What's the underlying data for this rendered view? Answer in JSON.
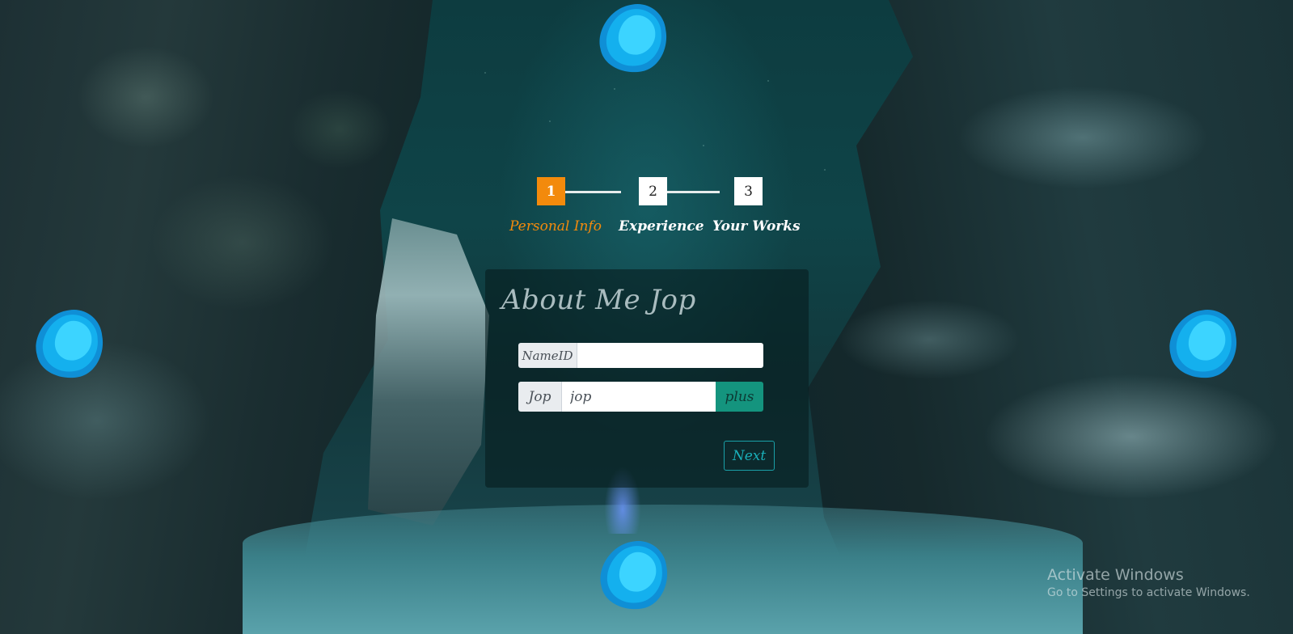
{
  "stepper": {
    "steps": [
      {
        "number": "1",
        "label": "Personal Info",
        "active": true
      },
      {
        "number": "2",
        "label": "Experience",
        "active": false
      },
      {
        "number": "3",
        "label": "Your Works",
        "active": false
      }
    ]
  },
  "form": {
    "title": "About Me Jop",
    "name_field": {
      "prefix": "NameID",
      "value": "",
      "placeholder": ""
    },
    "job_field": {
      "prefix": "Jop",
      "value": "jop",
      "button_label": "plus"
    },
    "next_label": "Next"
  },
  "watermark": {
    "title": "Activate Windows",
    "subtitle": "Go to Settings to activate Windows."
  },
  "colors": {
    "active_step": "#f38a0c",
    "plus_button": "#14947e",
    "next_border": "#1aa0a8",
    "blob": "#13b8f0"
  },
  "icons": [
    "blob-decoration"
  ]
}
